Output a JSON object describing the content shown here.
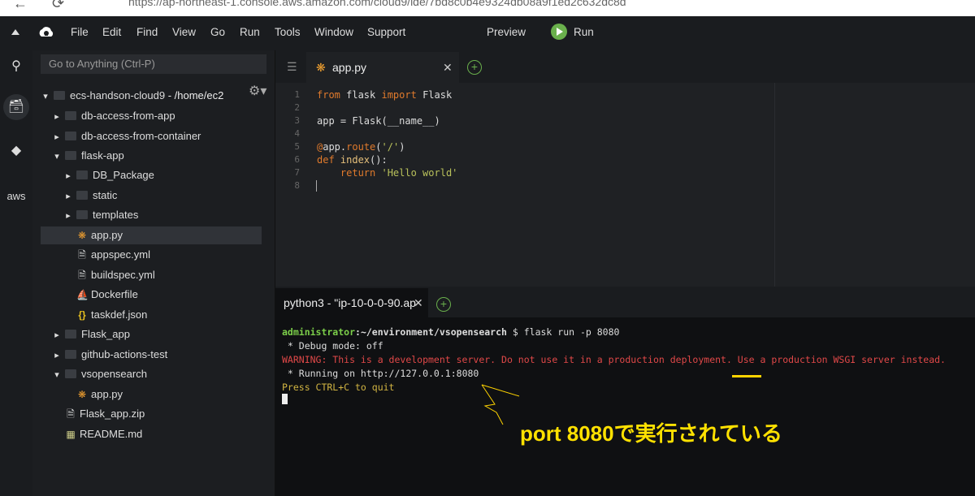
{
  "browser": {
    "url": "https://ap-northeast-1.console.aws.amazon.com/cloud9/ide/7bd8c0b4e9324db08a9f1ed2c632dc8d"
  },
  "menu": {
    "items": [
      "File",
      "Edit",
      "Find",
      "View",
      "Go",
      "Run",
      "Tools",
      "Window",
      "Support"
    ],
    "preview_label": "Preview",
    "run_label": "Run"
  },
  "sidebar": {
    "search_placeholder": "Go to Anything (Ctrl-P)",
    "root_label": "ecs-handson-cloud9",
    "root_path": " - /home/ec2",
    "tree": [
      {
        "label": "db-access-from-app",
        "type": "folder",
        "expanded": false
      },
      {
        "label": "db-access-from-container",
        "type": "folder",
        "expanded": false
      },
      {
        "label": "flask-app",
        "type": "folder",
        "expanded": true
      },
      {
        "label": "DB_Package",
        "type": "folder",
        "expanded": false
      },
      {
        "label": "static",
        "type": "folder",
        "expanded": false
      },
      {
        "label": "templates",
        "type": "folder",
        "expanded": false
      },
      {
        "label": "app.py",
        "type": "python",
        "selected": true
      },
      {
        "label": "appspec.yml",
        "type": "file"
      },
      {
        "label": "buildspec.yml",
        "type": "file"
      },
      {
        "label": "Dockerfile",
        "type": "docker"
      },
      {
        "label": "taskdef.json",
        "type": "json"
      },
      {
        "label": "Flask_app",
        "type": "folder",
        "expanded": false
      },
      {
        "label": "github-actions-test",
        "type": "folder",
        "expanded": false
      },
      {
        "label": "vsopensearch",
        "type": "folder",
        "expanded": true
      },
      {
        "label": "app.py",
        "type": "python"
      },
      {
        "label": "Flask_app.zip",
        "type": "zip"
      },
      {
        "label": "README.md",
        "type": "markdown"
      }
    ]
  },
  "editor": {
    "tab_label": "app.py",
    "line_numbers": [
      "1",
      "2",
      "3",
      "4",
      "5",
      "6",
      "7",
      "8"
    ],
    "code": {
      "l1_kw1": "from",
      "l1_mod": " flask ",
      "l1_kw2": "import",
      "l1_rest": " Flask",
      "l3": "app = Flask(__name__)",
      "l5_dec": "@",
      "l5_a": "app.",
      "l5_fn": "route",
      "l5_p1": "(",
      "l5_str": "'/'",
      "l5_p2": ")",
      "l6_kw": "def",
      "l6_fn": " index",
      "l6_rest": "():",
      "l7_kw": "    return",
      "l7_sp": " ",
      "l7_str": "'Hello world'"
    }
  },
  "terminal": {
    "tab_label": "python3 - \"ip-10-0-0-90.ap",
    "prompt_user": "administrator",
    "prompt_path": ":~/environment/vsopensearch",
    "prompt_cmd": " $ flask run -p 8080",
    "line2": " * Debug mode: off",
    "line3": "WARNING: This is a development server. Do not use it in a production deployment. Use a production WSGI server instead.",
    "line4_a": " * Running on http://127.0.0.1:",
    "line4_port": "8080",
    "line5": "Press CTRL+C to quit"
  },
  "annotation": {
    "text": "port 8080で実行されている",
    "color": "#ffe100"
  },
  "colors": {
    "accent_green": "#6ab04c",
    "python_orange": "#f0a030"
  }
}
